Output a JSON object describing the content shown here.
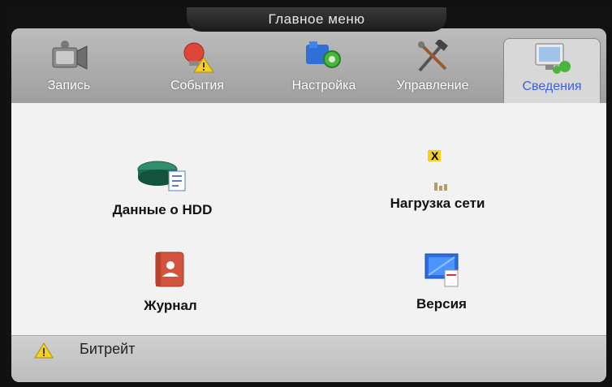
{
  "window": {
    "title": "Главное меню"
  },
  "tabs": [
    {
      "label": "Запись",
      "icon": "camcorder-icon"
    },
    {
      "label": "События",
      "icon": "alarm-bell-icon"
    },
    {
      "label": "Настройка",
      "icon": "settings-gear-icon"
    },
    {
      "label": "Управление",
      "icon": "tools-icon"
    },
    {
      "label": "Сведения",
      "icon": "info-monitor-icon",
      "active": true
    }
  ],
  "items": [
    {
      "label": "Данные о HDD",
      "icon": "hdd-icon"
    },
    {
      "label": "Нагрузка сети",
      "icon": "network-load-icon"
    },
    {
      "label": "Журнал",
      "icon": "log-book-icon"
    },
    {
      "label": "Версия",
      "icon": "version-monitor-icon"
    }
  ],
  "status": {
    "text": "Битрейт",
    "icon": "warning-icon"
  },
  "colors": {
    "active_tab_label": "#3f5fd8",
    "menu_background": "#f2f2f2"
  }
}
